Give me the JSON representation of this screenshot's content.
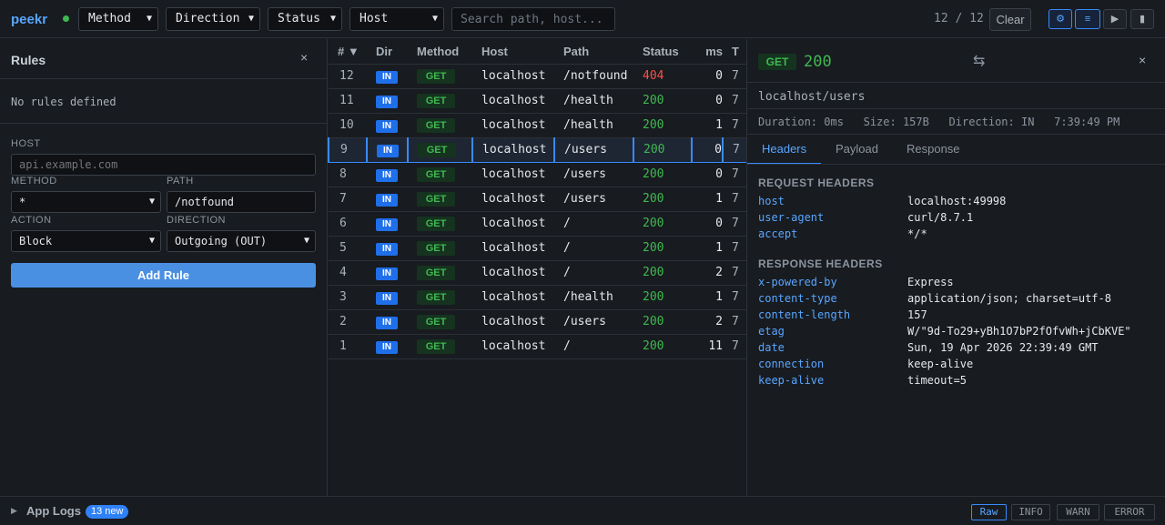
{
  "app": {
    "name": "peekr"
  },
  "filters": {
    "method": "Method",
    "direction": "Direction",
    "status": "Status",
    "host": "Host",
    "search_placeholder": "Search path, host..."
  },
  "toolbar": {
    "count": "12 / 12",
    "clear_label": "Clear",
    "settings_icon": "⚙",
    "list_icon": "≡",
    "play_icon": "▶",
    "pause_icon": "▮"
  },
  "rules": {
    "title": "Rules",
    "close_icon": "×",
    "empty_text": "No rules defined",
    "host_label": "HOST",
    "host_placeholder": "api.example.com",
    "method_label": "METHOD",
    "method_value": "*",
    "path_label": "PATH",
    "path_value": "/notfound",
    "action_label": "ACTION",
    "action_value": "Block",
    "direction_label": "DIRECTION",
    "direction_value": "Outgoing (OUT)",
    "add_label": "Add Rule"
  },
  "table": {
    "columns": [
      "# ▼",
      "Dir",
      "Method",
      "Host",
      "Path",
      "Status",
      "ms",
      "T"
    ],
    "rows": [
      {
        "num": "12",
        "dir": "IN",
        "method": "GET",
        "host": "localhost",
        "path": "/notfound",
        "status": "404",
        "ms": "0",
        "t": "7"
      },
      {
        "num": "11",
        "dir": "IN",
        "method": "GET",
        "host": "localhost",
        "path": "/health",
        "status": "200",
        "ms": "0",
        "t": "7"
      },
      {
        "num": "10",
        "dir": "IN",
        "method": "GET",
        "host": "localhost",
        "path": "/health",
        "status": "200",
        "ms": "1",
        "t": "7"
      },
      {
        "num": "9",
        "dir": "IN",
        "method": "GET",
        "host": "localhost",
        "path": "/users",
        "status": "200",
        "ms": "0",
        "t": "7"
      },
      {
        "num": "8",
        "dir": "IN",
        "method": "GET",
        "host": "localhost",
        "path": "/users",
        "status": "200",
        "ms": "0",
        "t": "7"
      },
      {
        "num": "7",
        "dir": "IN",
        "method": "GET",
        "host": "localhost",
        "path": "/users",
        "status": "200",
        "ms": "1",
        "t": "7"
      },
      {
        "num": "6",
        "dir": "IN",
        "method": "GET",
        "host": "localhost",
        "path": "/",
        "status": "200",
        "ms": "0",
        "t": "7"
      },
      {
        "num": "5",
        "dir": "IN",
        "method": "GET",
        "host": "localhost",
        "path": "/",
        "status": "200",
        "ms": "1",
        "t": "7"
      },
      {
        "num": "4",
        "dir": "IN",
        "method": "GET",
        "host": "localhost",
        "path": "/",
        "status": "200",
        "ms": "2",
        "t": "7"
      },
      {
        "num": "3",
        "dir": "IN",
        "method": "GET",
        "host": "localhost",
        "path": "/health",
        "status": "200",
        "ms": "1",
        "t": "7"
      },
      {
        "num": "2",
        "dir": "IN",
        "method": "GET",
        "host": "localhost",
        "path": "/users",
        "status": "200",
        "ms": "2",
        "t": "7"
      },
      {
        "num": "1",
        "dir": "IN",
        "method": "GET",
        "host": "localhost",
        "path": "/",
        "status": "200",
        "ms": "11",
        "t": "7"
      }
    ],
    "selected_num": "9"
  },
  "detail": {
    "method": "GET",
    "status": "200",
    "swap_icon": "⇆",
    "close_icon": "×",
    "url": "localhost/users",
    "meta": "Duration: 0ms   Size: 157B   Direction: IN   7:39:49 PM",
    "tabs": [
      "Headers",
      "Payload",
      "Response"
    ],
    "request_title": "REQUEST HEADERS",
    "request_headers": [
      {
        "k": "host",
        "v": "localhost:49998"
      },
      {
        "k": "user-agent",
        "v": "curl/8.7.1"
      },
      {
        "k": "accept",
        "v": "*/*"
      }
    ],
    "response_title": "RESPONSE HEADERS",
    "response_headers": [
      {
        "k": "x-powered-by",
        "v": "Express"
      },
      {
        "k": "content-type",
        "v": "application/json; charset=utf-8"
      },
      {
        "k": "content-length",
        "v": "157"
      },
      {
        "k": "etag",
        "v": "W/\"9d-To29+yBh1O7bP2fOfvWh+jCbKVE\""
      },
      {
        "k": "date",
        "v": "Sun, 19 Apr 2026 22:39:49 GMT"
      },
      {
        "k": "connection",
        "v": "keep-alive"
      },
      {
        "k": "keep-alive",
        "v": "timeout=5"
      }
    ]
  },
  "logs": {
    "arrow": "▶",
    "title": "App Logs",
    "badge": "13 new",
    "levels": [
      "Raw",
      "INFO",
      "WARN",
      "ERROR"
    ]
  },
  "colors": {
    "accent": "#58a6ff",
    "ok": "#3fb950",
    "error": "#f85149",
    "bg": "#181b20"
  }
}
